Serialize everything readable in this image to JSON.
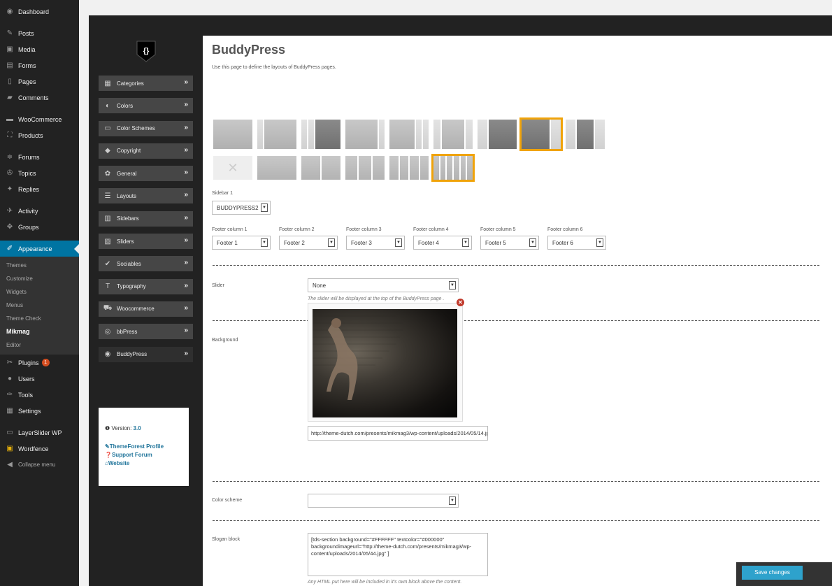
{
  "wp_menu": {
    "dashboard": "Dashboard",
    "posts": "Posts",
    "media": "Media",
    "forms": "Forms",
    "pages": "Pages",
    "comments": "Comments",
    "woocommerce": "WooCommerce",
    "products": "Products",
    "forums": "Forums",
    "topics": "Topics",
    "replies": "Replies",
    "activity": "Activity",
    "groups": "Groups",
    "appearance": "Appearance",
    "sub": {
      "themes": "Themes",
      "customize": "Customize",
      "widgets": "Widgets",
      "menus": "Menus",
      "theme_check": "Theme Check",
      "mikmag": "Mikmag",
      "editor": "Editor"
    },
    "plugins": "Plugins",
    "plugins_badge": "1",
    "users": "Users",
    "tools": "Tools",
    "settings": "Settings",
    "layerslider": "LayerSlider WP",
    "wordfence": "Wordfence",
    "collapse": "Collapse menu"
  },
  "theme_nav": {
    "logo": "{}",
    "items": [
      {
        "label": "Categories",
        "icon": "grid-icon"
      },
      {
        "label": "Colors",
        "icon": "contrast-icon"
      },
      {
        "label": "Color Schemes",
        "icon": "monitor-icon"
      },
      {
        "label": "Copyright",
        "icon": "tag-icon"
      },
      {
        "label": "General",
        "icon": "gears-icon"
      },
      {
        "label": "Layouts",
        "icon": "list-icon"
      },
      {
        "label": "Sidebars",
        "icon": "columns-icon"
      },
      {
        "label": "Sliders",
        "icon": "image-icon"
      },
      {
        "label": "Sociables",
        "icon": "twitter-icon"
      },
      {
        "label": "Typography",
        "icon": "text-icon"
      },
      {
        "label": "Woocommerce",
        "icon": "cart-icon"
      },
      {
        "label": "bbPress",
        "icon": "bbpress-icon"
      },
      {
        "label": "BuddyPress",
        "icon": "buddypress-icon"
      }
    ],
    "chevron": "»"
  },
  "info": {
    "version_label": "Version:",
    "version": "3.0",
    "themeforest": "ThemeForest Profile",
    "support": "Support Forum",
    "website": "Website"
  },
  "page": {
    "title": "BuddyPress",
    "description": "Use this page to define the layouts of BuddyPress pages."
  },
  "sidebar1": {
    "label": "Sidebar 1",
    "value": "BUDDYPRESS2"
  },
  "footer": [
    {
      "label": "Footer column 1",
      "value": "Footer 1"
    },
    {
      "label": "Footer column 2",
      "value": "Footer 2"
    },
    {
      "label": "Footer column 3",
      "value": "Footer 3"
    },
    {
      "label": "Footer column 4",
      "value": "Footer 4"
    },
    {
      "label": "Footer column 5",
      "value": "Footer 5"
    },
    {
      "label": "Footer column 6",
      "value": "Footer 6"
    }
  ],
  "slider": {
    "label": "Slider",
    "value": "None",
    "hint": "The slider will be displayed at the top of the BuddyPress page ."
  },
  "background": {
    "label": "Background",
    "url": "http://theme-dutch.com/presents/mikmag3/wp-content/uploads/2014/05/14.jp"
  },
  "color_scheme": {
    "label": "Color scheme",
    "value": ""
  },
  "slogan": {
    "label": "Slogan block",
    "value": "[tds-section background=\"#FFFFFF\" textcolor=\"#000000\" backgroundimageurl=\"http://theme-dutch.com/presents/mikmag3/wp-content/uploads/2014/05/44.jpg\" ]",
    "hint": "Any HTML put here will be included in it's own block above the content."
  },
  "save_button": "Save changes",
  "colors": {
    "accent": "#0074a2",
    "selected_border": "#f0a30a",
    "button": "#2ea2cc"
  }
}
